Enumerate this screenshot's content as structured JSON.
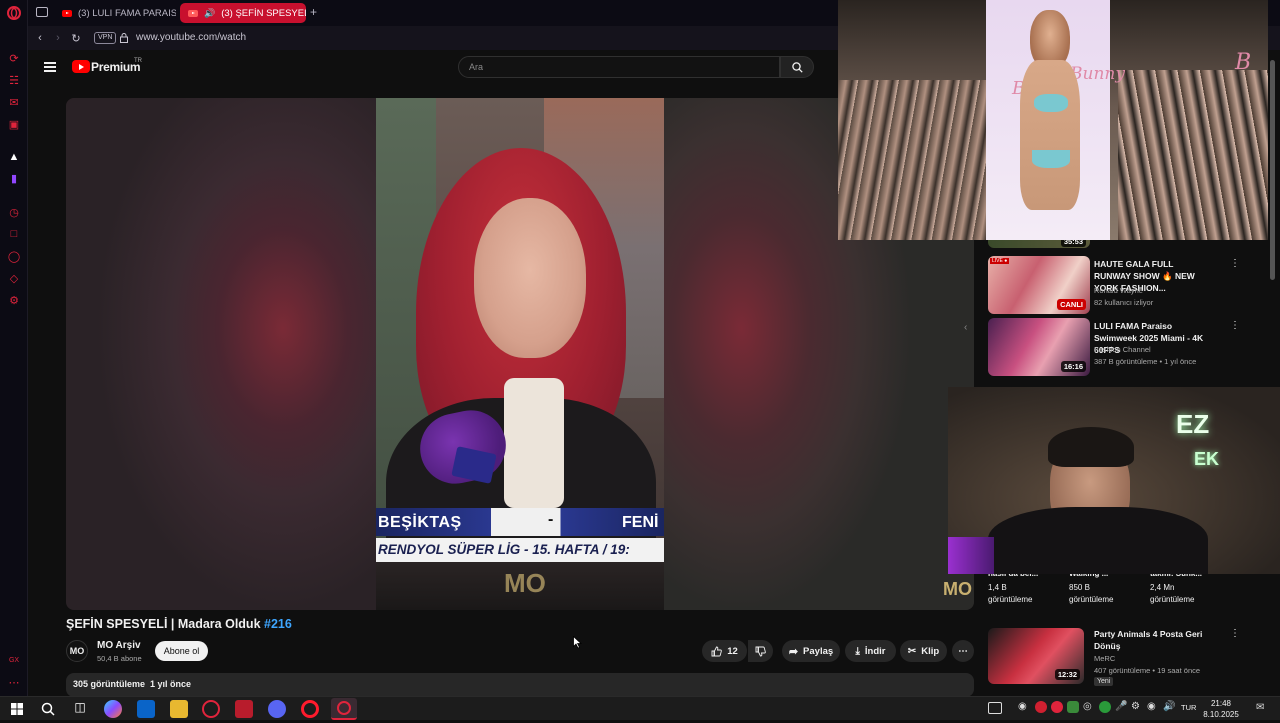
{
  "browser": {
    "tabs": [
      {
        "label": "(3) LULI FAMA PARAISO •",
        "active": false
      },
      {
        "label": "(3) ŞEFİN SPESYELİ |",
        "active": true
      }
    ],
    "new_tab_label": "+",
    "vpn_label": "VPN",
    "url": "www.youtube.com/watch"
  },
  "youtube": {
    "brand": "Premium",
    "region": "TR",
    "search_placeholder": "Ara"
  },
  "player": {
    "lower_third_left": "BEŞİKTAŞ",
    "lower_third_mid": "-",
    "lower_third_right": "FENİ",
    "lower_third_bottom": "RENDYOL SÜPER LİG - 15. HAFTA / 19:",
    "watermark": "MO",
    "corner_logo": "MO"
  },
  "video": {
    "title": "ŞEFİN SPESYELİ | Madara Olduk",
    "hashtag": "#216",
    "channel_initials": "MO",
    "channel_name": "MO Arşiv",
    "subscribers": "50,4 B abone",
    "subscribe_label": "Abone ol",
    "like_count": "12",
    "share_label": "Paylaş",
    "download_label": "İndir",
    "clip_label": "Klip",
    "views": "305 görüntüleme",
    "age": "1 yıl önce"
  },
  "recommendations": [
    {
      "title": "HAUTE GALA FULL RUNWAY SHOW 🔥 NEW YORK FASHION...",
      "channel": "Ronald Wayne",
      "meta": "82 kullanıcı izliyor",
      "badge": "CANLI",
      "live_label": "LIVE ●"
    },
    {
      "title": "LULI FAMA Paraiso Swimweek 2025 Miami - 4K 60FPS",
      "channel": "Fashion Channel",
      "meta": "387 B görüntüleme • 1 yıl önce",
      "duration": "16:16"
    },
    {
      "title": "Party Animals 4 Posta Geri Dönüş",
      "channel": "MeRC",
      "meta": "407 görüntüleme • 19 saat önce",
      "badge": "Yeni",
      "duration": "12:32"
    }
  ],
  "partial_row": [
    {
      "title": "nasil da bel...",
      "views": "1,4 B",
      "unit": "görüntüleme"
    },
    {
      "title": "Walking ...",
      "views": "850 B",
      "unit": "görüntüleme"
    },
    {
      "title": "takmi: Sunk...",
      "views": "2,4 Mn",
      "unit": "görüntüleme"
    }
  ],
  "top_thumb_duration": "35:53",
  "pip": {
    "runway_brand": "Bunny",
    "runway_brand_prefix": "B",
    "webcam_sign_1": "EZ",
    "webcam_sign_2": "EK"
  },
  "taskbar": {
    "lang": "TUR",
    "time": "21:48",
    "date": "8.10.2025"
  },
  "colors": {
    "opera_red": "#e0243c",
    "active_tab": "#c8102e",
    "hashtag_blue": "#3ea6ff",
    "yt_red": "#ff0000"
  }
}
